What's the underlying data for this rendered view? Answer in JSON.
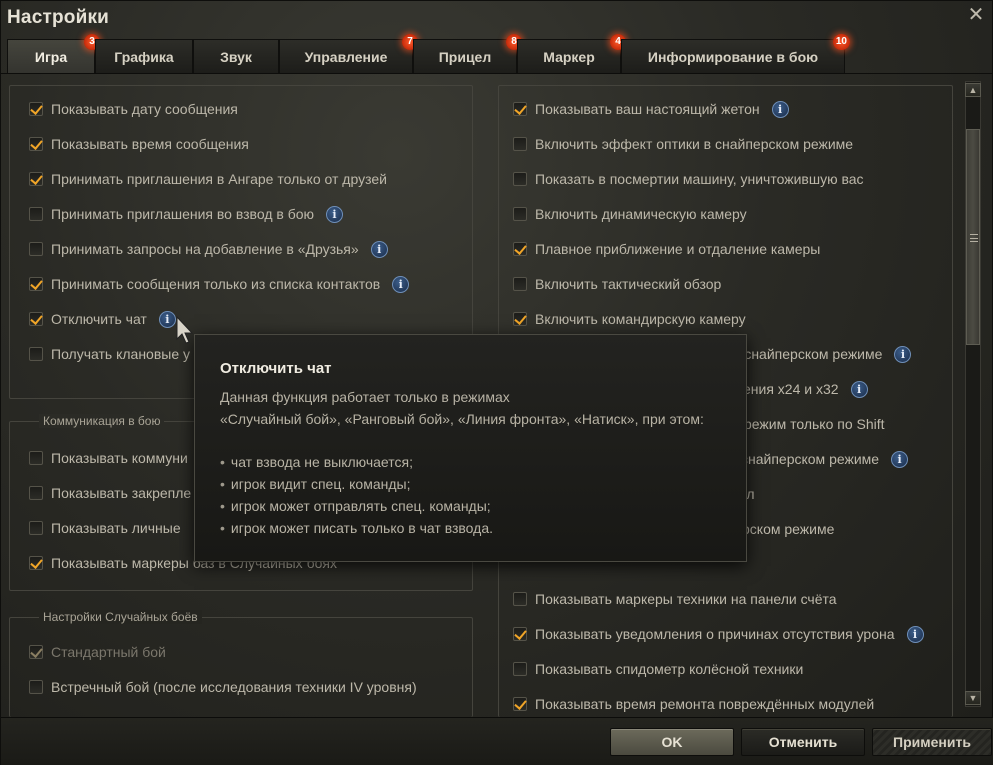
{
  "window": {
    "title": "Настройки",
    "close": "✕"
  },
  "tabs": [
    {
      "label": "Игра",
      "badge": "3"
    },
    {
      "label": "Графика",
      "badge": ""
    },
    {
      "label": "Звук",
      "badge": ""
    },
    {
      "label": "Управление",
      "badge": "7"
    },
    {
      "label": "Прицел",
      "badge": "8"
    },
    {
      "label": "Маркер",
      "badge": "4"
    },
    {
      "label": "Информирование в бою",
      "badge": "10"
    }
  ],
  "left": {
    "general": [
      {
        "label": "Показывать дату сообщения",
        "checked": true,
        "info": false
      },
      {
        "label": "Показывать время сообщения",
        "checked": true,
        "info": false
      },
      {
        "label": "Принимать приглашения в Ангаре только от друзей",
        "checked": true,
        "info": false
      },
      {
        "label": "Принимать приглашения во взвод в бою",
        "checked": false,
        "info": true
      },
      {
        "label": "Принимать запросы на добавление в «Друзья»",
        "checked": false,
        "info": true
      },
      {
        "label": "Принимать сообщения только из списка контактов",
        "checked": true,
        "info": true
      },
      {
        "label": "Отключить чат",
        "checked": true,
        "info": true
      },
      {
        "label": "Получать клановые у",
        "checked": false,
        "info": false
      }
    ],
    "battle_comm": {
      "title": "Коммуникация в бою",
      "items": [
        {
          "label": "Показывать коммуни",
          "checked": false
        },
        {
          "label": "Показывать закрепле",
          "checked": false
        },
        {
          "label": "Показывать личные",
          "checked": false
        },
        {
          "label": "Показывать маркеры баз в Случайных боях",
          "checked": true
        }
      ]
    },
    "random": {
      "title": "Настройки Случайных боёв",
      "items": [
        {
          "label": "Стандартный бой",
          "checked": true,
          "disabled": true
        },
        {
          "label": "Встречный бой (после исследования техники IV уровня)",
          "checked": false,
          "disabled": false
        }
      ]
    }
  },
  "right": [
    {
      "label": "Показывать ваш настоящий жетон",
      "checked": true,
      "info": true
    },
    {
      "label": "Включить эффект оптики в снайперском режиме",
      "checked": false,
      "info": false
    },
    {
      "label": "Показать в посмертии машину, уничтожившую вас",
      "checked": false,
      "info": false
    },
    {
      "label": "Включить динамическую камеру",
      "checked": false,
      "info": false
    },
    {
      "label": "Плавное приближение и отдаление камеры",
      "checked": true,
      "info": false
    },
    {
      "label": "Включить тактический обзор",
      "checked": false,
      "info": false
    },
    {
      "label": "Включить командирскую камеру",
      "checked": true,
      "info": false
    },
    {
      "label": "в снайперском режиме",
      "checked": false,
      "info": true
    },
    {
      "label": "ения x24 и x32",
      "checked": false,
      "info": true
    },
    {
      "label": "режим только по Shift",
      "checked": false,
      "info": false
    },
    {
      "label": "снайперском режиме",
      "checked": false,
      "info": true
    },
    {
      "label": "ел",
      "checked": false,
      "info": false
    },
    {
      "label": "рском режиме",
      "checked": false,
      "info": false
    },
    {
      "label": "",
      "checked": false,
      "info": false
    },
    {
      "label": "Показывать маркеры техники на панели счёта",
      "checked": false,
      "info": false
    },
    {
      "label": "Показывать уведомления о причинах отсутствия урона",
      "checked": true,
      "info": true
    },
    {
      "label": "Показывать спидометр колёсной техники",
      "checked": false,
      "info": false
    },
    {
      "label": "Показывать время ремонта повреждённых модулей",
      "checked": true,
      "info": false
    }
  ],
  "tooltip": {
    "title": "Отключить чат",
    "lines": [
      "Данная функция работает только в режимах",
      "«Случайный бой», «Ранговый бой», «Линия фронта», «Натиск», при этом:"
    ],
    "bullets": [
      "чат взвода не выключается;",
      "игрок видит спец. команды;",
      "игрок может отправлять спец. команды;",
      "игрок может писать только в чат взвода."
    ]
  },
  "buttons": {
    "ok": "OK",
    "cancel": "Отменить",
    "apply": "Применить"
  },
  "colors": {
    "accent_check": "#f0a528",
    "badge": "#e0401a",
    "info": "#3b5d8a"
  }
}
